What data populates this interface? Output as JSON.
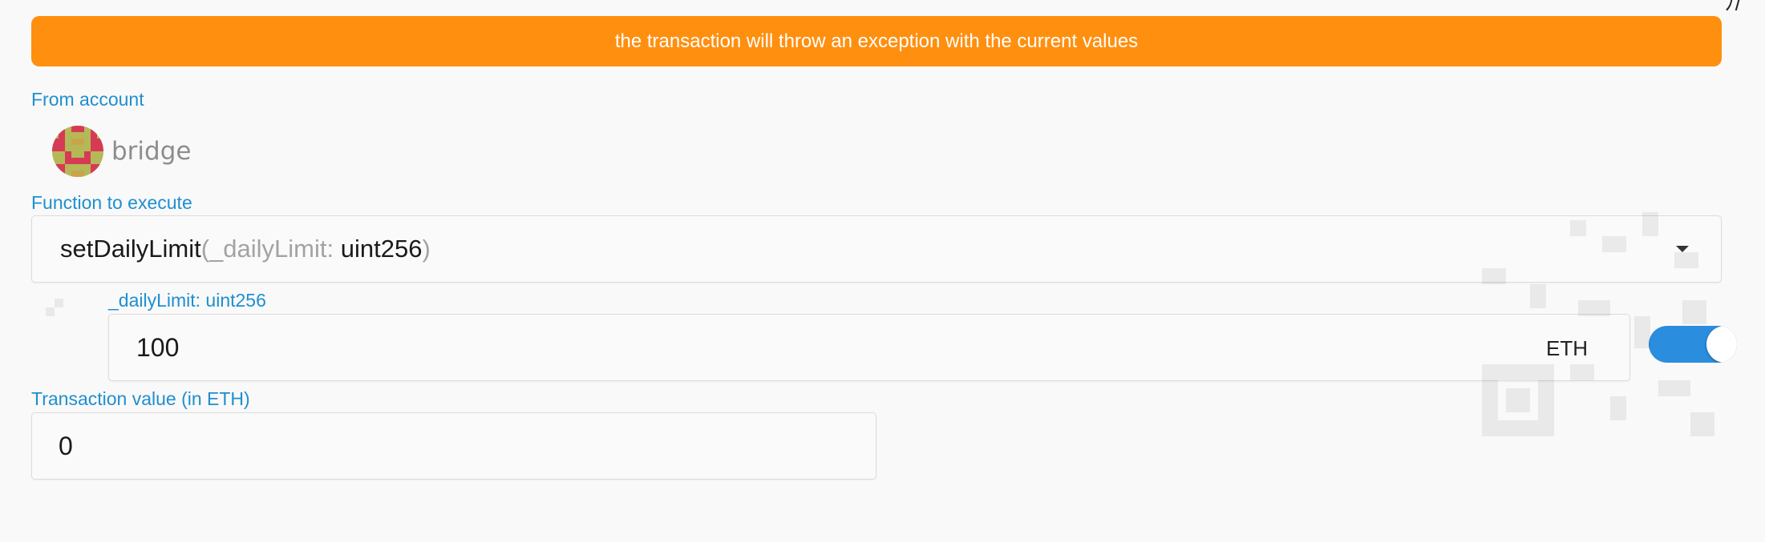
{
  "banner": {
    "message": "the transaction will throw an exception with the current values",
    "color": "#ff8f0f"
  },
  "from_account": {
    "label": "From account",
    "name": "bridge",
    "avatar_icon": "identicon"
  },
  "function_select": {
    "label": "Function to execute",
    "function_name": "setDailyLimit",
    "open_paren": "(",
    "param_name": "_dailyLimit:",
    "param_type": "uint256",
    "close_paren": ")",
    "icon": "caret-down-icon"
  },
  "param": {
    "label": "_dailyLimit: uint256",
    "value": "100",
    "unit": "ETH",
    "unit_toggle_on": true
  },
  "tx_value": {
    "label": "Transaction value (in ETH)",
    "value": "0"
  },
  "colors": {
    "accent": "#1f8fcf",
    "toggle": "#2b8ddd",
    "background": "#f9f9f9"
  }
}
